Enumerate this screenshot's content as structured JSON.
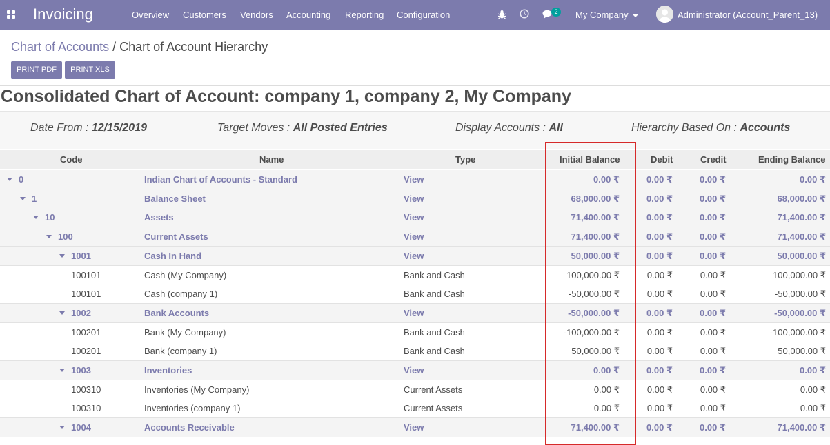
{
  "navbar": {
    "app_title": "Invoicing",
    "menu": [
      "Overview",
      "Customers",
      "Vendors",
      "Accounting",
      "Reporting",
      "Configuration"
    ],
    "messages_badge": "2",
    "company": "My Company",
    "user": "Administrator (Account_Parent_13)"
  },
  "breadcrumb": {
    "parent": "Chart of Accounts",
    "separator": "/",
    "current": "Chart of Account Hierarchy"
  },
  "buttons": {
    "print_pdf": "PRINT PDF",
    "print_xls": "PRINT XLS"
  },
  "report": {
    "title": "Consolidated Chart of Account: company 1, company 2, My Company",
    "filters": {
      "date_from_label": "Date From : ",
      "date_from": "12/15/2019",
      "target_moves_label": "Target Moves : ",
      "target_moves": "All Posted Entries",
      "display_accounts_label": "Display Accounts : ",
      "display_accounts": "All",
      "hierarchy_label": "Hierarchy Based On : ",
      "hierarchy": "Accounts"
    }
  },
  "table": {
    "columns": [
      "Code",
      "Name",
      "Type",
      "Initial Balance",
      "Debit",
      "Credit",
      "Ending Balance"
    ],
    "rows": [
      {
        "level": 0,
        "parent": true,
        "code": "0",
        "name": "Indian Chart of Accounts - Standard",
        "type": "View",
        "initial": "0.00 ₹",
        "debit": "0.00 ₹",
        "credit": "0.00 ₹",
        "ending": "0.00 ₹"
      },
      {
        "level": 1,
        "parent": true,
        "code": "1",
        "name": "Balance Sheet",
        "type": "View",
        "initial": "68,000.00 ₹",
        "debit": "0.00 ₹",
        "credit": "0.00 ₹",
        "ending": "68,000.00 ₹"
      },
      {
        "level": 2,
        "parent": true,
        "code": "10",
        "name": "Assets",
        "type": "View",
        "initial": "71,400.00 ₹",
        "debit": "0.00 ₹",
        "credit": "0.00 ₹",
        "ending": "71,400.00 ₹"
      },
      {
        "level": 3,
        "parent": true,
        "code": "100",
        "name": "Current Assets",
        "type": "View",
        "initial": "71,400.00 ₹",
        "debit": "0.00 ₹",
        "credit": "0.00 ₹",
        "ending": "71,400.00 ₹"
      },
      {
        "level": 4,
        "parent": true,
        "code": "1001",
        "name": "Cash In Hand",
        "type": "View",
        "initial": "50,000.00 ₹",
        "debit": "0.00 ₹",
        "credit": "0.00 ₹",
        "ending": "50,000.00 ₹"
      },
      {
        "level": 5,
        "parent": false,
        "code": "100101",
        "name": "Cash (My Company)",
        "type": "Bank and Cash",
        "initial": "100,000.00 ₹",
        "debit": "0.00 ₹",
        "credit": "0.00 ₹",
        "ending": "100,000.00 ₹"
      },
      {
        "level": 5,
        "parent": false,
        "code": "100101",
        "name": "Cash (company 1)",
        "type": "Bank and Cash",
        "initial": "-50,000.00 ₹",
        "debit": "0.00 ₹",
        "credit": "0.00 ₹",
        "ending": "-50,000.00 ₹"
      },
      {
        "level": 4,
        "parent": true,
        "code": "1002",
        "name": "Bank Accounts",
        "type": "View",
        "initial": "-50,000.00 ₹",
        "debit": "0.00 ₹",
        "credit": "0.00 ₹",
        "ending": "-50,000.00 ₹"
      },
      {
        "level": 5,
        "parent": false,
        "code": "100201",
        "name": "Bank (My Company)",
        "type": "Bank and Cash",
        "initial": "-100,000.00 ₹",
        "debit": "0.00 ₹",
        "credit": "0.00 ₹",
        "ending": "-100,000.00 ₹"
      },
      {
        "level": 5,
        "parent": false,
        "code": "100201",
        "name": "Bank (company 1)",
        "type": "Bank and Cash",
        "initial": "50,000.00 ₹",
        "debit": "0.00 ₹",
        "credit": "0.00 ₹",
        "ending": "50,000.00 ₹"
      },
      {
        "level": 4,
        "parent": true,
        "code": "1003",
        "name": "Inventories",
        "type": "View",
        "initial": "0.00 ₹",
        "debit": "0.00 ₹",
        "credit": "0.00 ₹",
        "ending": "0.00 ₹"
      },
      {
        "level": 5,
        "parent": false,
        "code": "100310",
        "name": "Inventories (My Company)",
        "type": "Current Assets",
        "initial": "0.00 ₹",
        "debit": "0.00 ₹",
        "credit": "0.00 ₹",
        "ending": "0.00 ₹"
      },
      {
        "level": 5,
        "parent": false,
        "code": "100310",
        "name": "Inventories (company 1)",
        "type": "Current Assets",
        "initial": "0.00 ₹",
        "debit": "0.00 ₹",
        "credit": "0.00 ₹",
        "ending": "0.00 ₹"
      },
      {
        "level": 4,
        "parent": true,
        "code": "1004",
        "name": "Accounts Receivable",
        "type": "View",
        "initial": "71,400.00 ₹",
        "debit": "0.00 ₹",
        "credit": "0.00 ₹",
        "ending": "71,400.00 ₹"
      }
    ]
  },
  "colors": {
    "brand": "#7c7bad",
    "badge": "#00a09d",
    "highlight": "#d62a2a"
  }
}
